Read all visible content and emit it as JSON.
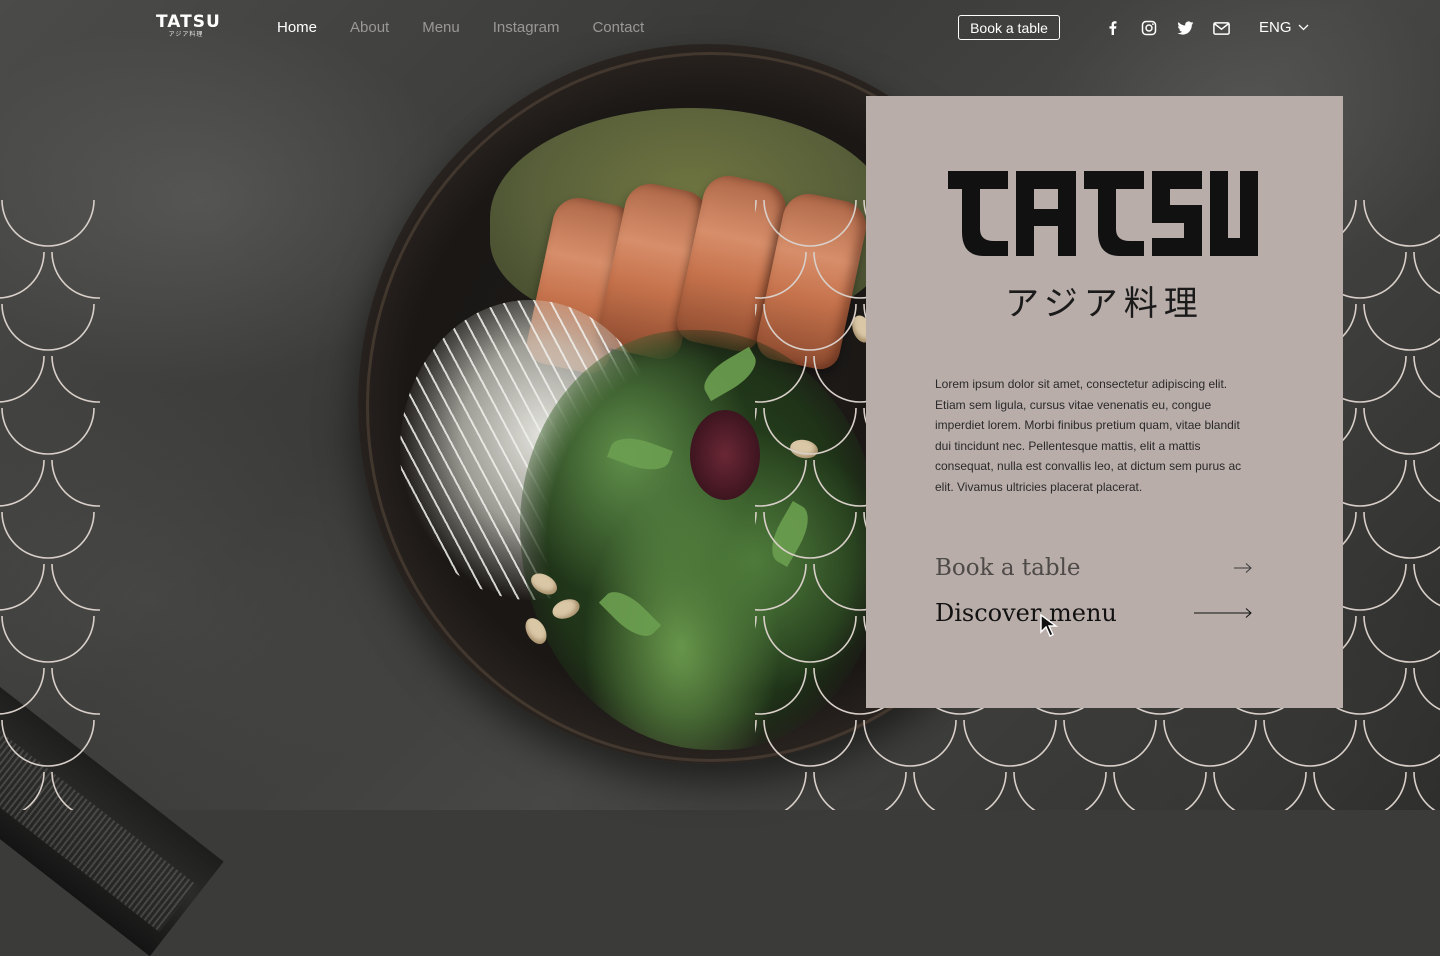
{
  "brand": {
    "logo_word": "TATSU",
    "logo_sub": "アジア料理"
  },
  "nav": {
    "links": [
      {
        "label": "Home",
        "active": true
      },
      {
        "label": "About",
        "active": false
      },
      {
        "label": "Menu",
        "active": false
      },
      {
        "label": "Instagram",
        "active": false
      },
      {
        "label": "Contact",
        "active": false
      }
    ],
    "book_button": "Book a table",
    "socials": [
      "facebook-icon",
      "instagram-icon",
      "twitter-icon",
      "mail-icon"
    ],
    "language": "ENG"
  },
  "hero": {
    "title": "TATSU",
    "subtitle": "アジア料理",
    "description": "Lorem ipsum dolor sit amet, consectetur adipiscing elit. Etiam sem ligula, cursus vitae venenatis eu, congue imperdiet lorem. Morbi finibus pretium quam, vitae blandit dui tincidunt nec. Pellentesque mattis, elit a mattis consequat, nulla est convallis leo, at dictum sem purus ac elit. Vivamus ultricies placerat placerat.",
    "cta_book": "Book a table",
    "cta_menu": "Discover menu"
  },
  "colors": {
    "card_bg": "#b8ada9",
    "text_dark": "#111111",
    "nav_inactive": "#9a9896",
    "nav_active": "#ffffff"
  }
}
